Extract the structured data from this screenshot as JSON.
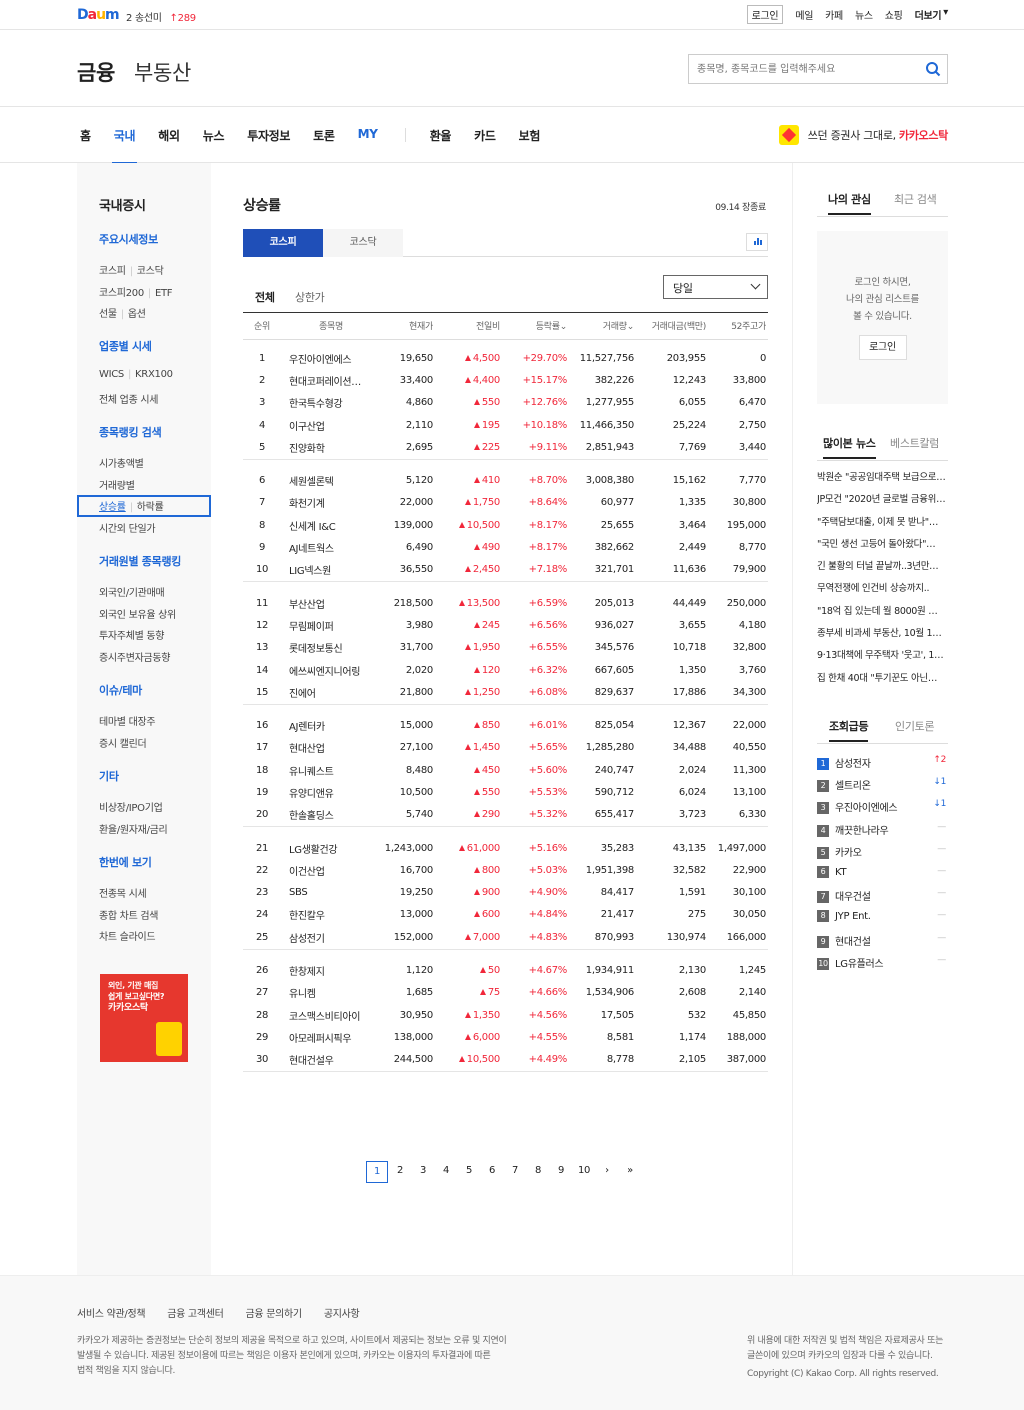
{
  "topbar": {
    "logo": "Daum",
    "rank_num": "2",
    "rank_word": "송선미",
    "rank_up": "289",
    "links": [
      "로그인",
      "메일",
      "카페",
      "뉴스",
      "쇼핑",
      "더보기"
    ]
  },
  "header": {
    "brand": "금융",
    "brand2": "부동산",
    "search_placeholder": "종목명, 종목코드를 입력해주세요"
  },
  "nav": {
    "items": [
      "홈",
      "국내",
      "해외",
      "뉴스",
      "투자정보",
      "토론",
      "MY"
    ],
    "items2": [
      "환율",
      "카드",
      "보험"
    ],
    "ad_text": "쓰던 증권사 그대로,",
    "ad_brand": "카카오스탁"
  },
  "lnb": {
    "title": "국내증시",
    "groups": [
      {
        "title": "주요시세정보",
        "rows": [
          [
            "코스피",
            "코스닥"
          ],
          [
            "코스피200",
            "ETF"
          ],
          [
            "선물",
            "옵션"
          ]
        ]
      },
      {
        "title": "업종별 시세",
        "rows": [
          [
            "WICS",
            "KRX100"
          ],
          [
            "전체 업종 시세"
          ]
        ]
      },
      {
        "title": "종목랭킹 검색",
        "rows": [
          [
            "시가총액별"
          ],
          [
            "거래량별"
          ],
          [
            "상승률",
            "하락률"
          ],
          [
            "시간외 단일가"
          ]
        ]
      },
      {
        "title": "거래원별 종목랭킹",
        "rows": [
          [
            "외국인/기관매매"
          ],
          [
            "외국인 보유율 상위"
          ],
          [
            "투자주체별 동향"
          ],
          [
            "증시주변자금동향"
          ]
        ]
      },
      {
        "title": "이슈/테마",
        "rows": [
          [
            "테마별 대장주"
          ],
          [
            "증시 캘린더"
          ]
        ]
      },
      {
        "title": "기타",
        "rows": [
          [
            "비상장/IPO기업"
          ],
          [
            "환율/원자재/금리"
          ]
        ]
      },
      {
        "title": "한번에 보기",
        "rows": [
          [
            "전종목 시세"
          ],
          [
            "종합 차트 검색"
          ],
          [
            "차트 슬라이드"
          ]
        ]
      }
    ],
    "ad_lines": [
      "외인, 기관 매집",
      "쉽게 보고싶다면?",
      "카카오스탁"
    ]
  },
  "main": {
    "title": "상승률",
    "status": "09.14 장종료",
    "market_tabs": [
      "코스피",
      "코스닥"
    ],
    "sub_tabs": [
      "전체",
      "상한가"
    ],
    "period": "당일",
    "headers": [
      "순위",
      "종목명",
      "현재가",
      "전일비",
      "등락률",
      "거래량",
      "거래대금(백만)",
      "52주고가"
    ],
    "rows": [
      [
        "1",
        "우진아이엔에스",
        "19,650",
        "4,500",
        "+29.70%",
        "11,527,756",
        "203,955",
        "0"
      ],
      [
        "2",
        "현대코퍼레이션…",
        "33,400",
        "4,400",
        "+15.17%",
        "382,226",
        "12,243",
        "33,800"
      ],
      [
        "3",
        "한국특수형강",
        "4,860",
        "550",
        "+12.76%",
        "1,277,955",
        "6,055",
        "6,470"
      ],
      [
        "4",
        "이구산업",
        "2,110",
        "195",
        "+10.18%",
        "11,466,350",
        "25,224",
        "2,750"
      ],
      [
        "5",
        "진양화학",
        "2,695",
        "225",
        "+9.11%",
        "2,851,943",
        "7,769",
        "3,440"
      ],
      [
        "6",
        "세원셀론텍",
        "5,120",
        "410",
        "+8.70%",
        "3,008,380",
        "15,162",
        "7,770"
      ],
      [
        "7",
        "화천기계",
        "22,000",
        "1,750",
        "+8.64%",
        "60,977",
        "1,335",
        "30,800"
      ],
      [
        "8",
        "신세계 I&C",
        "139,000",
        "10,500",
        "+8.17%",
        "25,655",
        "3,464",
        "195,000"
      ],
      [
        "9",
        "AJ네트웍스",
        "6,490",
        "490",
        "+8.17%",
        "382,662",
        "2,449",
        "8,770"
      ],
      [
        "10",
        "LIG넥스원",
        "36,550",
        "2,450",
        "+7.18%",
        "321,701",
        "11,636",
        "79,900"
      ],
      [
        "11",
        "부산산업",
        "218,500",
        "13,500",
        "+6.59%",
        "205,013",
        "44,449",
        "250,000"
      ],
      [
        "12",
        "무림페이퍼",
        "3,980",
        "245",
        "+6.56%",
        "936,027",
        "3,655",
        "4,180"
      ],
      [
        "13",
        "롯데정보통신",
        "31,700",
        "1,950",
        "+6.55%",
        "345,576",
        "10,718",
        "32,800"
      ],
      [
        "14",
        "에쓰씨엔지니어링",
        "2,020",
        "120",
        "+6.32%",
        "667,605",
        "1,350",
        "3,760"
      ],
      [
        "15",
        "진에어",
        "21,800",
        "1,250",
        "+6.08%",
        "829,637",
        "17,886",
        "34,300"
      ],
      [
        "16",
        "AJ렌터카",
        "15,000",
        "850",
        "+6.01%",
        "825,054",
        "12,367",
        "22,000"
      ],
      [
        "17",
        "현대산업",
        "27,100",
        "1,450",
        "+5.65%",
        "1,285,280",
        "34,488",
        "40,550"
      ],
      [
        "18",
        "유니퀘스트",
        "8,480",
        "450",
        "+5.60%",
        "240,747",
        "2,024",
        "11,300"
      ],
      [
        "19",
        "유양디앤유",
        "10,500",
        "550",
        "+5.53%",
        "590,712",
        "6,024",
        "13,100"
      ],
      [
        "20",
        "한솔홀딩스",
        "5,740",
        "290",
        "+5.32%",
        "655,417",
        "3,723",
        "6,330"
      ],
      [
        "21",
        "LG생활건강",
        "1,243,000",
        "61,000",
        "+5.16%",
        "35,283",
        "43,135",
        "1,497,000"
      ],
      [
        "22",
        "이건산업",
        "16,700",
        "800",
        "+5.03%",
        "1,951,398",
        "32,582",
        "22,900"
      ],
      [
        "23",
        "SBS",
        "19,250",
        "900",
        "+4.90%",
        "84,417",
        "1,591",
        "30,100"
      ],
      [
        "24",
        "한진칼우",
        "13,000",
        "600",
        "+4.84%",
        "21,417",
        "275",
        "30,050"
      ],
      [
        "25",
        "삼성전기",
        "152,000",
        "7,000",
        "+4.83%",
        "870,993",
        "130,974",
        "166,000"
      ],
      [
        "26",
        "한창제지",
        "1,120",
        "50",
        "+4.67%",
        "1,934,911",
        "2,130",
        "1,245"
      ],
      [
        "27",
        "유니켐",
        "1,685",
        "75",
        "+4.66%",
        "1,534,906",
        "2,608",
        "2,140"
      ],
      [
        "28",
        "코스맥스비티아이",
        "30,950",
        "1,350",
        "+4.56%",
        "17,505",
        "532",
        "45,850"
      ],
      [
        "29",
        "아모레퍼시픽우",
        "138,000",
        "6,000",
        "+4.55%",
        "8,581",
        "1,174",
        "188,000"
      ],
      [
        "30",
        "현대건설우",
        "244,500",
        "10,500",
        "+4.49%",
        "8,778",
        "2,105",
        "387,000"
      ]
    ],
    "pages": [
      "1",
      "2",
      "3",
      "4",
      "5",
      "6",
      "7",
      "8",
      "9",
      "10"
    ],
    "next": "›",
    "last": "»"
  },
  "aside": {
    "tabs1": [
      "나의 관심",
      "최근 검색"
    ],
    "login_lines": [
      "로그인 하시면,",
      "나의 관심 리스트를",
      "볼 수 있습니다."
    ],
    "login_btn": "로그인",
    "tabs2": [
      "많이본 뉴스",
      "베스트칼럼"
    ],
    "news": [
      "박원순 \"공공임대주택 보급으로…",
      "JP모건 \"2020년 글로벌 금융위기…",
      "\"주택담보대출, 이제 못 받나\"…",
      "\"국민 생선 고등어 돌아왔다\"…",
      "긴 불황의 터널 끝날까..3년만…",
      "무역전쟁에 인건비 상승까지..",
      "\"18억 집 있는데 월 8000원 …",
      "종부세 비과세 부동산, 10월 1…",
      "9·13대책에 무주택자 '웃고', 1…",
      "집 한채 40대 \"투기꾼도 아닌…"
    ],
    "tabs3": [
      "조회급등",
      "인기토론"
    ],
    "popular": [
      {
        "n": "1",
        "name": "삼성전자",
        "mv": "2",
        "dir": "up"
      },
      {
        "n": "2",
        "name": "셀트리온",
        "mv": "1",
        "dir": "down"
      },
      {
        "n": "3",
        "name": "우진아이엔에스",
        "mv": "1",
        "dir": "down"
      },
      {
        "n": "4",
        "name": "깨끗한나라우",
        "mv": "—",
        "dir": "none"
      },
      {
        "n": "5",
        "name": "카카오",
        "mv": "—",
        "dir": "none"
      },
      {
        "n": "6",
        "name": "KT",
        "mv": "—",
        "dir": "none"
      },
      {
        "n": "7",
        "name": "대우건설",
        "mv": "—",
        "dir": "none"
      },
      {
        "n": "8",
        "name": "JYP Ent.",
        "mv": "—",
        "dir": "none"
      },
      {
        "n": "9",
        "name": "현대건설",
        "mv": "—",
        "dir": "none"
      },
      {
        "n": "10",
        "name": "LG유플러스",
        "mv": "—",
        "dir": "none"
      }
    ]
  },
  "footer": {
    "links": [
      "서비스 약관/정책",
      "금융 고객센터",
      "금융 문의하기",
      "공지사항"
    ],
    "disclaimer": [
      "카카오가 제공하는 증권정보는 단순히 정보의 제공을 목적으로 하고 있으며, 사이트에서 제공되는 정보는 오류 및 지연이",
      "발생될 수 있습니다. 제공된 정보이용에 따르는 책임은 이용자 본인에게 있으며, 카카오는 이용자의 투자결과에 따른",
      "법적 책임을 지지 않습니다."
    ],
    "right": [
      "위 내용에 대한 저작권 및 법적 책임은 자료제공사 또는",
      "글쓴이에 있으며 카카오의 입장과 다를 수 있습니다."
    ],
    "copyright": "Copyright (C) Kakao Corp. All rights reserved."
  },
  "colors": {
    "accent": "#1f68d6",
    "up": "#f1273a",
    "tab_active": "#1f4fb8"
  }
}
